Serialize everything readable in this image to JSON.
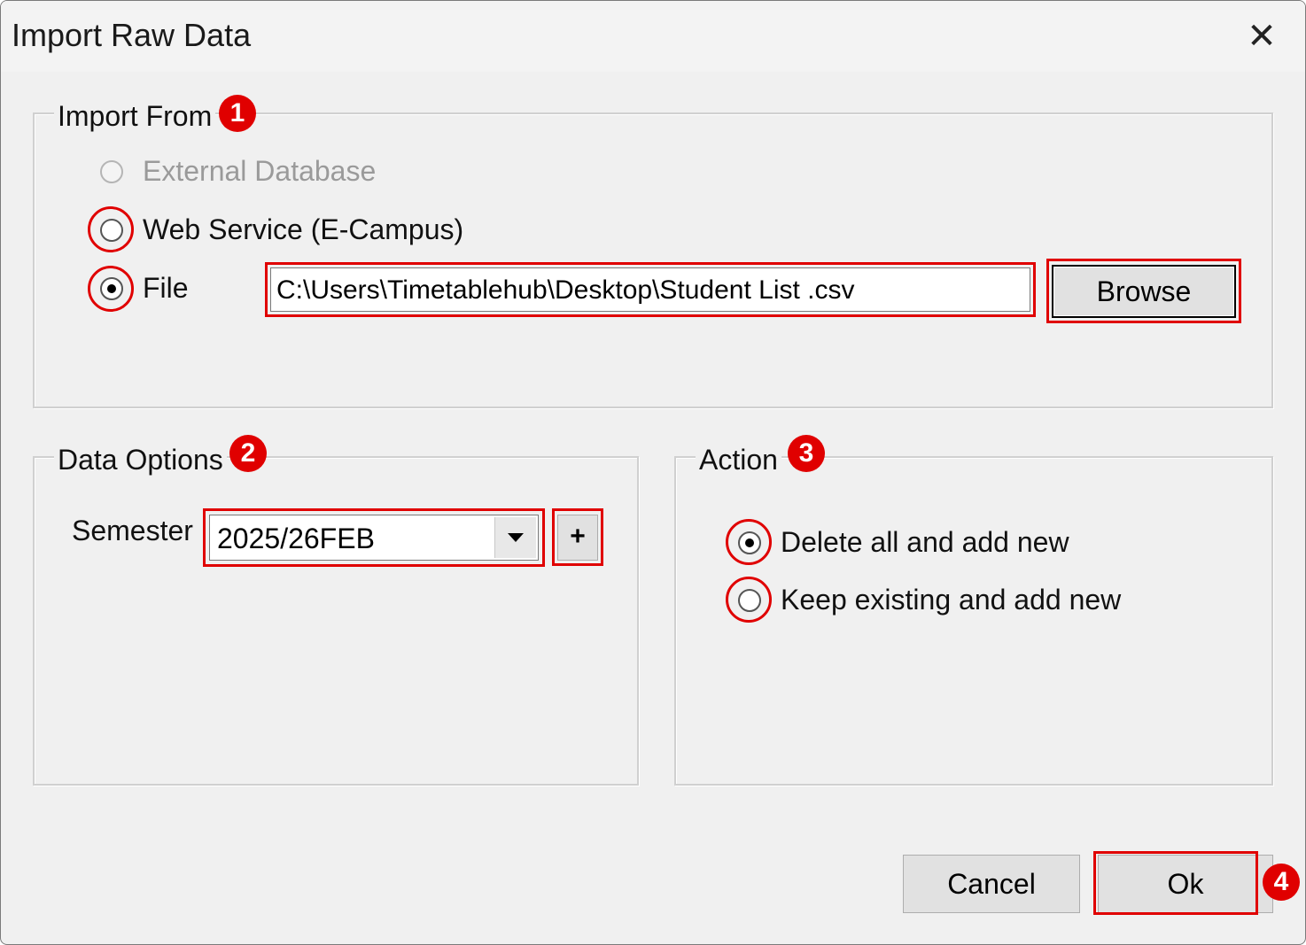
{
  "window": {
    "title": "Import Raw Data",
    "close_glyph": "✕"
  },
  "import_from": {
    "legend": "Import From",
    "badge": "1",
    "options": [
      {
        "label": "External Database",
        "state": "disabled"
      },
      {
        "label": "Web Service (E-Campus)",
        "state": "unchecked"
      },
      {
        "label": "File",
        "state": "checked"
      }
    ],
    "file_path": "C:\\Users\\Timetablehub\\Desktop\\Student List .csv",
    "browse_label": "Browse"
  },
  "data_options": {
    "legend": "Data Options",
    "badge": "2",
    "semester_label": "Semester",
    "semester_value": "2025/26FEB",
    "add_label": "+"
  },
  "action": {
    "legend": "Action",
    "badge": "3",
    "options": [
      {
        "label": "Delete all and add new",
        "state": "checked"
      },
      {
        "label": "Keep existing and add new",
        "state": "unchecked"
      }
    ]
  },
  "footer": {
    "cancel_label": "Cancel",
    "ok_label": "Ok",
    "badge": "4"
  },
  "colors": {
    "highlight": "#e00000",
    "dialog_bg": "#f0f0f0"
  }
}
